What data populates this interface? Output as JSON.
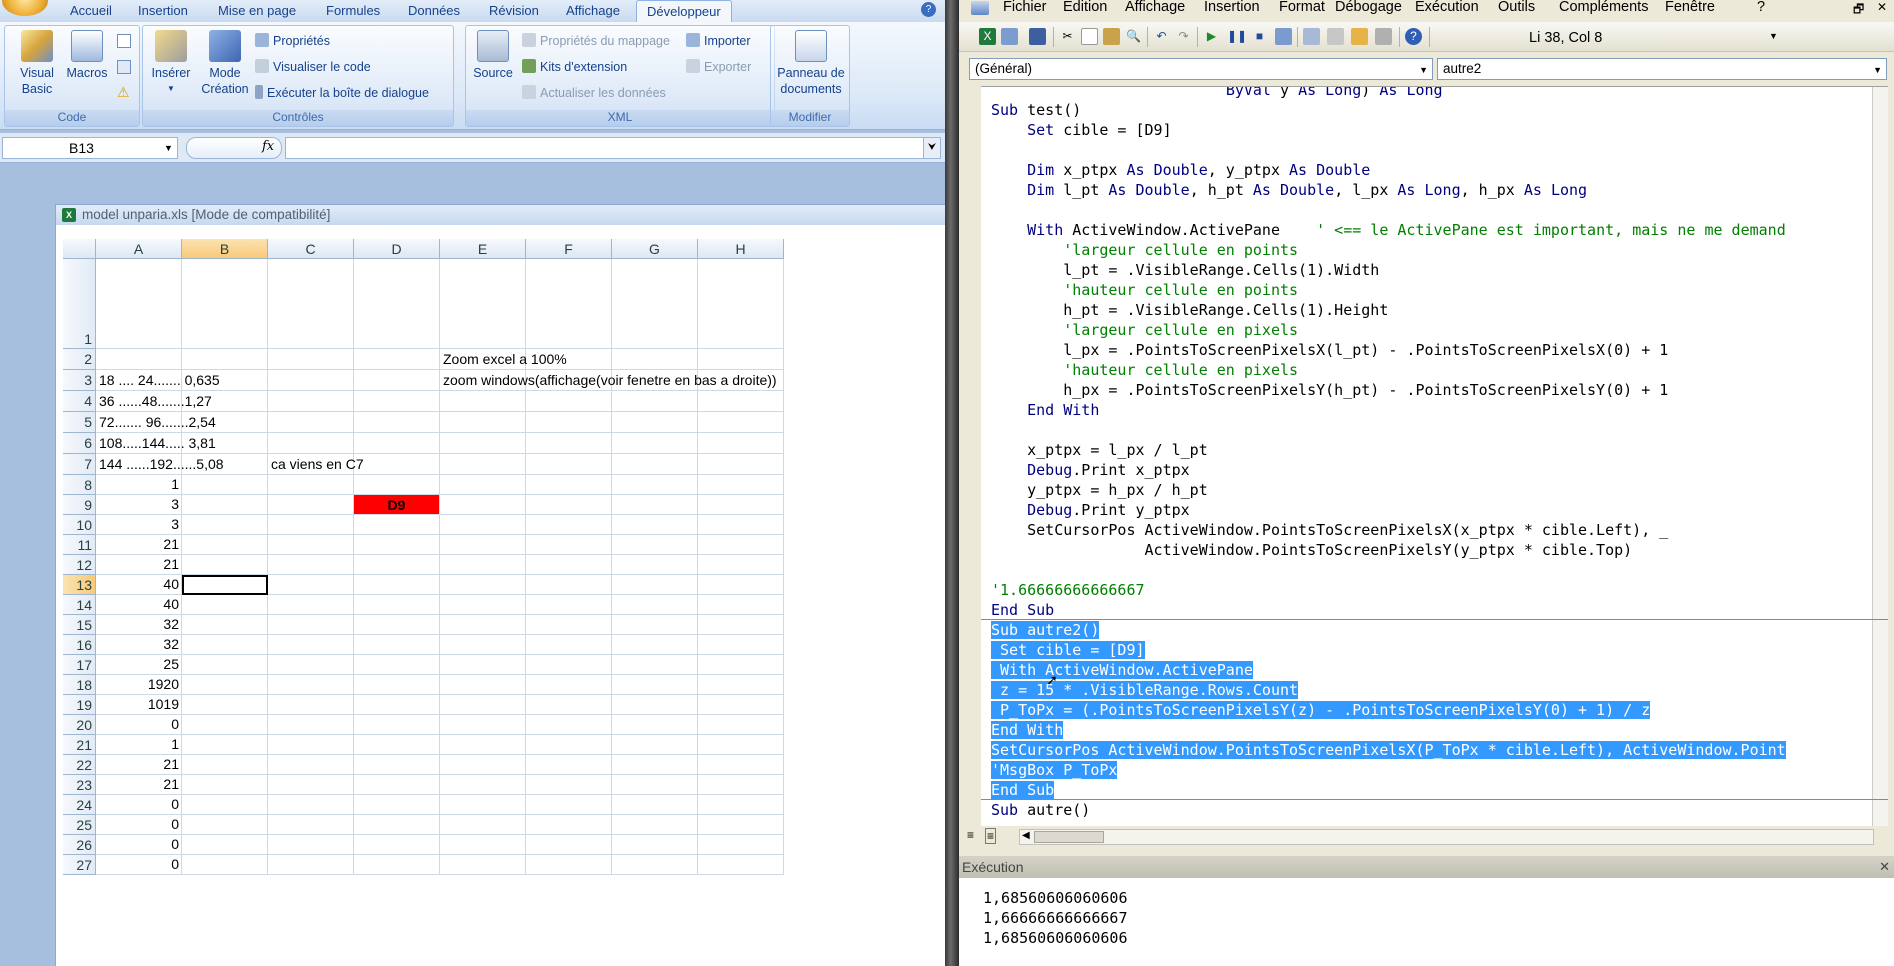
{
  "excel": {
    "tabs": [
      "Accueil",
      "Insertion",
      "Mise en page",
      "Formules",
      "Données",
      "Révision",
      "Affichage",
      "Développeur"
    ],
    "active_tab": "Développeur",
    "groups": {
      "code": {
        "label": "Code",
        "visual_basic": "Visual Basic",
        "macros": "Macros"
      },
      "controles": {
        "label": "Contrôles",
        "inserer": "Insérer",
        "mode_creation_1": "Mode",
        "mode_creation_2": "Création",
        "proprietes": "Propriétés",
        "visualiser_code": "Visualiser le code",
        "executer_dialogue": "Exécuter la boîte de dialogue"
      },
      "xml": {
        "label": "XML",
        "source": "Source",
        "proprietes_mappage": "Propriétés du mappage",
        "kits_extension": "Kits d'extension",
        "actualiser": "Actualiser les données",
        "importer": "Importer",
        "exporter": "Exporter"
      },
      "modifier": {
        "label": "Modifier",
        "panneau_1": "Panneau de",
        "panneau_2": "documents"
      }
    },
    "name_box": "B13",
    "fx": "fx",
    "workbook_title": "model unparia.xls  [Mode de compatibilité]",
    "columns": [
      "A",
      "B",
      "C",
      "D",
      "E",
      "F",
      "G",
      "H"
    ],
    "rows": [
      "1",
      "2",
      "3",
      "4",
      "5",
      "6",
      "7",
      "8",
      "9",
      "10",
      "11",
      "12",
      "13",
      "14",
      "15",
      "16",
      "17",
      "18",
      "19",
      "20",
      "21",
      "22",
      "23",
      "24",
      "25",
      "26",
      "27"
    ],
    "cells": {
      "A3": "18 .... 24....... 0,635",
      "A4": "36 ......48.......1,27",
      "A5": "72....... 96.......2,54",
      "A6": "108.....144..... 3,81",
      "A7": "144 ......192......5,08",
      "E2": "Zoom excel a 100%",
      "E3": "zoom windows(affichage(voir fenetre en bas a droite))",
      "C7": "ca viens en C7",
      "D9": "D9"
    },
    "numbers": [
      "1",
      "3",
      "3",
      "21",
      "21",
      "40",
      "40",
      "32",
      "32",
      "25",
      "1920",
      "1019",
      "0",
      "1",
      "21",
      "21",
      "0",
      "0",
      "0",
      "0"
    ]
  },
  "vbe": {
    "menu": [
      "Fichier",
      "Edition",
      "Affichage",
      "Insertion",
      "Format",
      "Débogage",
      "Exécution",
      "Outils",
      "Compléments",
      "Fenêtre",
      "?"
    ],
    "cursor_pos": "Li 38, Col 8",
    "object_combo": "(Général)",
    "proc_combo": "autre2",
    "code_lines": [
      "                          ByVal y As Long) As Long",
      "Sub test()",
      "    Set cible = [D9]",
      "",
      "    Dim x_ptpx As Double, y_ptpx As Double",
      "    Dim l_pt As Double, h_pt As Double, l_px As Long, h_px As Long",
      "",
      "    With ActiveWindow.ActivePane    ' <== le ActivePane est important, mais ne me demand",
      "        'largeur cellule en points",
      "        l_pt = .VisibleRange.Cells(1).Width",
      "        'hauteur cellule en points",
      "        h_pt = .VisibleRange.Cells(1).Height",
      "        'largeur cellule en pixels",
      "        l_px = .PointsToScreenPixelsX(l_pt) - .PointsToScreenPixelsX(0) + 1",
      "        'hauteur cellule en pixels",
      "        h_px = .PointsToScreenPixelsY(h_pt) - .PointsToScreenPixelsY(0) + 1",
      "    End With",
      "",
      "    x_ptpx = l_px / l_pt",
      "    Debug.Print x_ptpx",
      "    y_ptpx = h_px / h_pt",
      "    Debug.Print y_ptpx",
      "    SetCursorPos ActiveWindow.PointsToScreenPixelsX(x_ptpx * cible.Left), _",
      "                 ActiveWindow.PointsToScreenPixelsY(y_ptpx * cible.Top)",
      "",
      "'1.66666666666667",
      "End Sub",
      "Sub autre2()",
      " Set cible = [D9]",
      " With ActiveWindow.ActivePane",
      " z = 15 * .VisibleRange.Rows.Count",
      " P_ToPx = (.PointsToScreenPixelsY(z) - .PointsToScreenPixelsY(0) + 1) / z",
      "End With",
      "SetCursorPos ActiveWindow.PointsToScreenPixelsX(P_ToPx * cible.Left), ActiveWindow.Point",
      "'MsgBox P_ToPx",
      "End Sub",
      "Sub autre()"
    ],
    "immediate": {
      "title": "Exécution",
      "lines": [
        "1,68560606060606",
        "1,66666666666667",
        "1,68560606060606"
      ]
    }
  },
  "colors": {
    "excel_bg": "#a7bfde",
    "red_cell": "#ff0000",
    "selection": "#3399ff",
    "keyword": "#00007f",
    "comment": "#007f00"
  }
}
